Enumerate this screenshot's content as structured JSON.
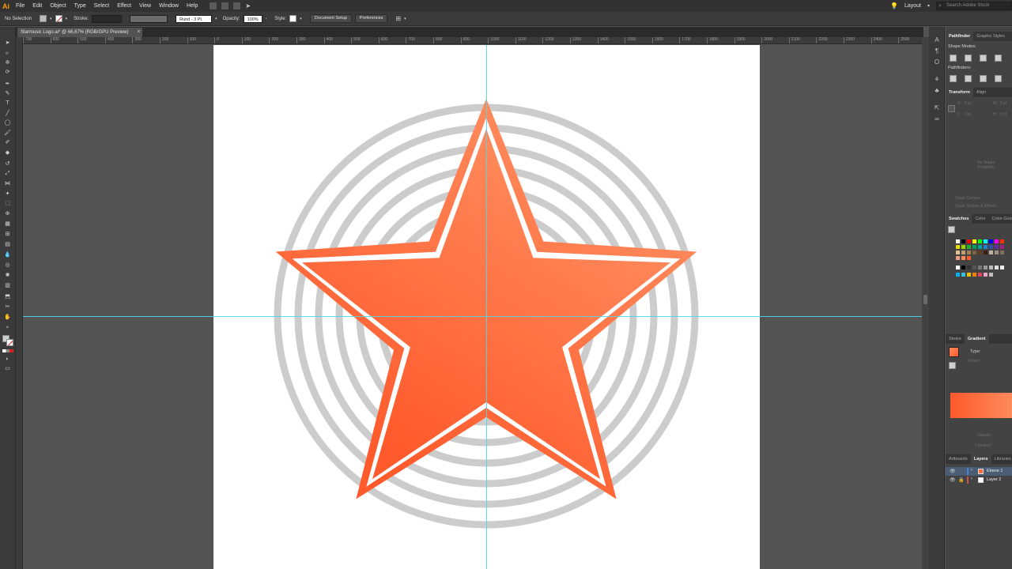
{
  "app": {
    "logo": "Ai",
    "menus": [
      "File",
      "Edit",
      "Object",
      "Type",
      "Select",
      "Effect",
      "View",
      "Window",
      "Help"
    ],
    "workspace": "Layout",
    "search_placeholder": "Search Adobe Stock"
  },
  "control_bar": {
    "selection": "No Selection",
    "stroke_label": "Stroke:",
    "brush_profile": "Rund - 3 Pt.",
    "opacity_label": "Opacity:",
    "opacity_value": "100%",
    "style_label": "Style:",
    "document_setup": "Document Setup",
    "preferences": "Preferences"
  },
  "document": {
    "tab_title": "Starmusic Logo.ai* @ 66,67% (RGB/GPU Preview)",
    "close_glyph": "×"
  },
  "ruler": {
    "ticks": [
      "700",
      "600",
      "500",
      "400",
      "300",
      "200",
      "100",
      "0",
      "100",
      "200",
      "300",
      "400",
      "500",
      "600",
      "700",
      "800",
      "900",
      "1000",
      "1100",
      "1200",
      "1300",
      "1400",
      "1500",
      "1600",
      "1700",
      "1800",
      "1900",
      "2000",
      "2100",
      "2200",
      "2300",
      "2400",
      "2500"
    ]
  },
  "panels": {
    "pathfinder_tabs": [
      "Pathfinder",
      "Graphic Styles"
    ],
    "shape_modes": "Shape Modes:",
    "pathfinders": "Pathfinders:",
    "transform_tabs": [
      "Transform",
      "Align"
    ],
    "transform_fields": [
      "X:",
      "Y:",
      "W:",
      "H:"
    ],
    "transform_values": [
      "0 pt",
      "0 pt",
      "0 pt",
      "0 pt"
    ],
    "no_shape": "No Shape Properties",
    "scale_corners": "Scale Corners",
    "scale_strokes": "Scale Strokes & Effects",
    "swatch_tabs": [
      "Swatches",
      "Color",
      "Color Guide"
    ],
    "gradient_tabs": [
      "Stroke",
      "Gradient"
    ],
    "type_label": "Type:",
    "stroke_label": "Stroke:",
    "opacity_label": "Opacity:",
    "location_label": "Location:",
    "layer_tabs": [
      "Artboards",
      "Layers",
      "Libraries"
    ],
    "layers": [
      {
        "name": "Ebene 1",
        "color": "#4f7fd8"
      },
      {
        "name": "Layer 2",
        "color": "#d84f4f"
      }
    ]
  },
  "colors": {
    "accent_star_top": "#ff8a5c",
    "accent_star_bottom": "#ff5a2c",
    "rings": "#cccccc",
    "guides": "#4fd6e6"
  }
}
